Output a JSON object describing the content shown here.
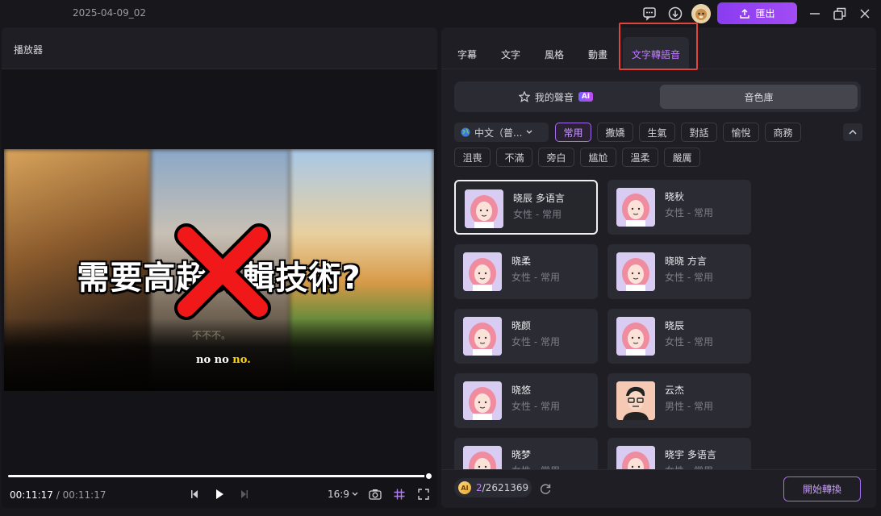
{
  "titlebar": {
    "project_title": "2025-04-09_02",
    "export_label": "匯出",
    "icons": [
      "feedback-icon",
      "download-icon",
      "avatar",
      "minimize-icon",
      "restore-icon",
      "close-icon"
    ]
  },
  "player": {
    "title": "播放器",
    "caption_main": "需要高超剪輯技術?",
    "caption_faint": "不不不。",
    "caption_small_a": "no no ",
    "caption_small_b": "no.",
    "progress": 1.0,
    "time_current": "00:11:17",
    "time_sep": " / ",
    "time_total": "00:11:17",
    "aspect": "16:9"
  },
  "panel": {
    "tabs": [
      {
        "label": "字幕"
      },
      {
        "label": "文字"
      },
      {
        "label": "風格"
      },
      {
        "label": "動畫"
      },
      {
        "label": "文字轉語音"
      }
    ],
    "active_tab": "文字轉語音",
    "segment": {
      "my_voice": "我的聲音",
      "ai_badge": "AI",
      "library": "音色庫"
    },
    "language": "中文（普...",
    "tags_row1": [
      "常用",
      "撒嬌",
      "生氣",
      "對話",
      "愉悅",
      "商務"
    ],
    "tags_row2": [
      "沮喪",
      "不滿",
      "旁白",
      "尴尬",
      "溫柔",
      "嚴厲"
    ],
    "selected_tag": "常用",
    "voices": [
      {
        "name": "晓辰 多语言",
        "desc": "女性 - 常用"
      },
      {
        "name": "晓秋",
        "desc": "女性 - 常用"
      },
      {
        "name": "晓柔",
        "desc": "女性 - 常用"
      },
      {
        "name": "晓晓 方言",
        "desc": "女性 - 常用"
      },
      {
        "name": "晓颜",
        "desc": "女性 - 常用"
      },
      {
        "name": "晓辰",
        "desc": "女性 - 常用"
      },
      {
        "name": "晓悠",
        "desc": "女性 - 常用"
      },
      {
        "name": "云杰",
        "desc": "男性 - 常用"
      },
      {
        "name": "晓梦",
        "desc": "女性 - 常用"
      },
      {
        "name": "晓宇 多语言",
        "desc": "女性 - 常用"
      }
    ],
    "credits_used": "2",
    "credits_total": "/2621369",
    "coin_label": "AI",
    "start_label": "開始轉換"
  },
  "colors": {
    "accent": "#a24cf4",
    "highlight_box": "#e0443a"
  }
}
